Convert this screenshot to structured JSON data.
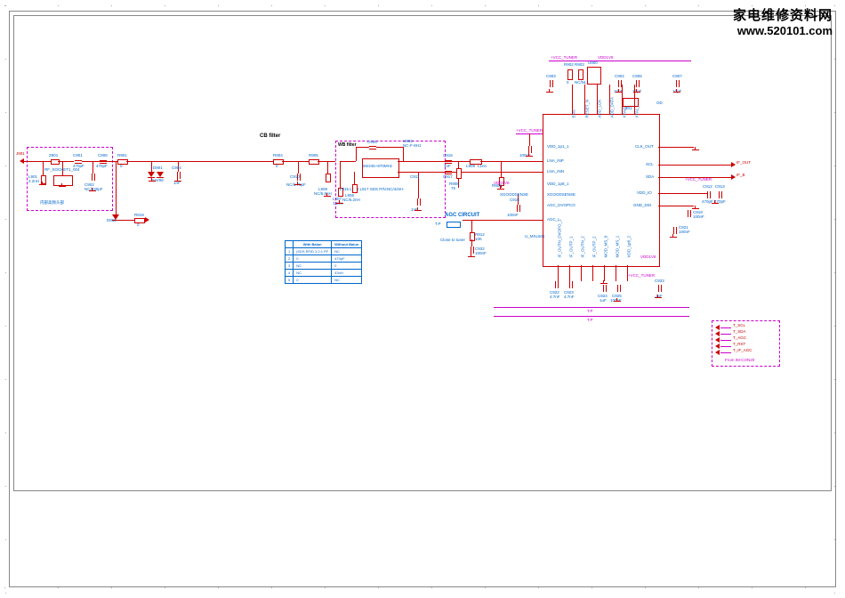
{
  "watermark": {
    "title_cn": "家电维修资料网",
    "url": "www.520101.com"
  },
  "sections": {
    "cb_filter": "CB filter",
    "wb_filter": "WB filter",
    "agc_circuit": "AGC CIRCUIT",
    "agc_tp": "T.P",
    "agc_note": "Close to tuner",
    "conn_block_cn": "内部高频头部"
  },
  "ports": {
    "rf_in": "J901",
    "if_out_p": "IF_OUT",
    "if_out_n": "IF_B"
  },
  "nets": {
    "vcc_tuner_t": "+VCC_TUNER",
    "vcc_tuner_r": "+VCC_TUNER",
    "vdd1v8_t": "VDD1V8",
    "vdd1v8_b": "VDD1V8",
    "tp": "T.P"
  },
  "ic": {
    "ref": "U_MXL601",
    "pins": {
      "p1": "VDD_1p1_1",
      "p2": "LNA_INP",
      "p3": "LNA_INN",
      "p4": "VDD_1p8_1",
      "p5": "XGOODSENSE",
      "p6": "AGC_DVOPCO",
      "p7": "AGC_I",
      "p8": "IF_OUTN_DVOPO_1",
      "p9": "IF_OUTP_1",
      "p10": "IF_OUTN_2",
      "p11": "IF_OUTP_2",
      "p12": "MOD_MS_0",
      "p13": "MOD_MS_1",
      "p14": "VDD_1p8_2",
      "p15": "GND_DIG",
      "p16": "VDD_IO",
      "p17": "SDA",
      "p18": "SCL",
      "p19": "CLK_OUT",
      "p20": "XTAL_N",
      "p21": "XTAL_P",
      "p22": "ADD_DATA",
      "p23": "ADD_LCK",
      "p24": "RESET_N",
      "p25": "ENS"
    }
  },
  "rf_input": {
    "socket": "RF_SOCKET1_004",
    "bead": "Z901",
    "l901": "L901",
    "l901_v": "2.2nH",
    "c901": "C901",
    "c901_v": "470pF",
    "c902": "C902",
    "c902_v": "NC/330pF",
    "r901": "R901",
    "r901_v": "0",
    "d901": "D901",
    "d901_v": "BAV99",
    "c904": "C904",
    "c904_v": "1nF",
    "c906": "C906",
    "c906_v": "470pF",
    "d911": "D911",
    "r919": "R919",
    "r919_v": "0"
  },
  "cb": {
    "r904": "R904",
    "r904_v": "0",
    "r905": "R905",
    "l906": "L906",
    "c909": "C909",
    "c910": "C910",
    "c910_v": "NC/6.75pF",
    "l908": "L908",
    "l908_v": "NC/6.8nH",
    "l907": "L907",
    "l907_v": "18nH"
  },
  "wb": {
    "u902": "U902",
    "u902_v": "NC-F-8H1",
    "u902_desc": "56/245~870MHz",
    "note": "L915 L916 L917 SDS P/N:NC/42nH",
    "c908": "C908",
    "l906v": "L906",
    "l906v_v": "NC/6.2nH",
    "c911": "C911",
    "c911_v": "1nF"
  },
  "coupling": {
    "c916": "C916",
    "c916_v": "1nF",
    "c917": "C917",
    "c917_v": "1nF",
    "l909": "L909",
    "l909_v": "L1nn",
    "r908": "R908",
    "r908_v": "75"
  },
  "agc": {
    "r912": "R912",
    "r912_v": "10K",
    "c932": "C932",
    "c932_v": "100nF",
    "c918": "C918",
    "c918_v": "100nF",
    "r909": "R909"
  },
  "power": {
    "c903": "C903",
    "r902": "R902",
    "r902_v": "0",
    "r903": "R903",
    "r903_v": "NC/NL",
    "c904t": "C904",
    "c904t_v": "10uF",
    "c905": "C905",
    "c905_v": "10pF",
    "c907": "C907",
    "c907_v": "10pF",
    "u900": "U900",
    "y901": "Y901",
    "c931": "C931",
    "c935": "C935",
    "c912": "C912",
    "c912_v": "470pF",
    "c913": "C913",
    "c913_v": "470pF",
    "c919": "C919",
    "c919_v": "100nF",
    "c921": "C921",
    "c921_v": "100nF",
    "c922": "C922",
    "c922_v": "4.7nF",
    "c923": "C923",
    "c923_v": "4.7nF",
    "c924": "C924",
    "c924_v": "1uF",
    "c925": "C925",
    "c925_v": "100nF",
    "c933": "C933",
    "c933_v": "1uF",
    "vcc_r": "+VCC_TUNER"
  },
  "bus_conn": {
    "title": "From IM-CON20",
    "p1": "T_SCL",
    "p2": "T_SDA",
    "p3": "T_AGC",
    "p4": "T_RST",
    "p5": "T_IF_AGC"
  },
  "legend": {
    "headers": [
      "",
      "With Balun",
      "Without Balun"
    ],
    "rows": [
      [
        "1",
        "|SDS RFID 1:2:1 PF",
        "NC"
      ],
      [
        "2",
        "0",
        "470pF"
      ],
      [
        "3",
        "NC",
        "0"
      ],
      [
        "4",
        "NC",
        "43nH"
      ],
      [
        "5",
        "0",
        "NC"
      ]
    ]
  }
}
